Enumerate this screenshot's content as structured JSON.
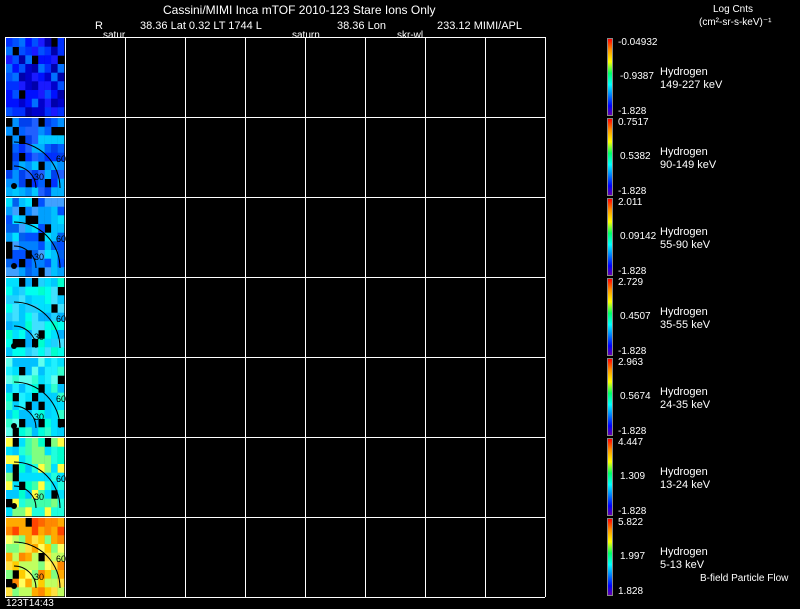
{
  "header": {
    "title": "Cassini/MIMI Inca mTOF  2010-123   Stare   Ions Only",
    "line2": {
      "r_label": "R",
      "r_value": "38.36 Lat 0.32 LT 1744 L",
      "l_value": "38.36 Lon",
      "lon_value": "233.12  MIMI/APL"
    },
    "line3": {
      "label_a": "satur",
      "label_b": "saturn",
      "label_c": "skr-wl"
    }
  },
  "units": {
    "line1": "Log Cnts",
    "line2": "(cm²-sr-s-keV)⁻¹"
  },
  "rows": [
    {
      "species": "Hydrogen",
      "energy": "149-227 keV",
      "cb_max": "-0.04932",
      "cb_mid": "-0.9387",
      "cb_min": "-1.828"
    },
    {
      "species": "Hydrogen",
      "energy": "90-149 keV",
      "cb_max": "0.7517",
      "cb_mid": "0.5382",
      "cb_min": "-1.828"
    },
    {
      "species": "Hydrogen",
      "energy": "55-90 keV",
      "cb_max": "2.011",
      "cb_mid": "0.09142",
      "cb_min": "-1.828"
    },
    {
      "species": "Hydrogen",
      "energy": "35-55 keV",
      "cb_max": "2.729",
      "cb_mid": "0.4507",
      "cb_min": "-1.828"
    },
    {
      "species": "Hydrogen",
      "energy": "24-35 keV",
      "cb_max": "2.963",
      "cb_mid": "0.5674",
      "cb_min": "-1.828"
    },
    {
      "species": "Hydrogen",
      "energy": "13-24 keV",
      "cb_max": "4.447",
      "cb_mid": "1.309",
      "cb_min": "-1.828"
    },
    {
      "species": "Hydrogen",
      "energy": "5-13 keV",
      "cb_max": "5.822",
      "cb_mid": "1.997",
      "cb_min": "1.828"
    }
  ],
  "panel_labels": {
    "inner": "30",
    "outer": "60"
  },
  "footer": {
    "time": "123T14:43",
    "bfield": "B-field Particle Flow"
  }
}
